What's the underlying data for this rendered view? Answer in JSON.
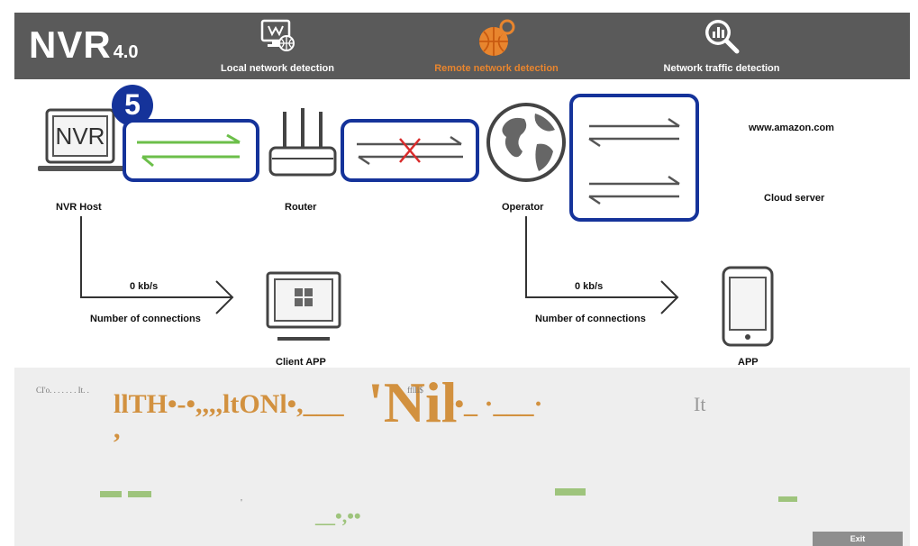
{
  "header": {
    "logo_main": "NVR",
    "logo_version": "4.0",
    "tabs": [
      {
        "label": "Local network detection",
        "icon": "monitor-network-icon"
      },
      {
        "label": "Remote network detection",
        "icon": "globe-search-icon",
        "active": true
      },
      {
        "label": "Network traffic detection",
        "icon": "magnifier-chart-icon"
      }
    ]
  },
  "diagram": {
    "step_number": "5",
    "nodes": {
      "nvr_host": "NVR Host",
      "nvr_screen_text": "NVR",
      "router": "Router",
      "operator": "Operator",
      "cloud_domain": "www.amazon.com",
      "cloud_server": "Cloud server",
      "client_app": "Client APP",
      "app": "APP"
    },
    "left_branch": {
      "speed": "0 kb/s",
      "connections_label": "Number of connections"
    },
    "right_branch": {
      "speed": "0 kb/s",
      "connections_label": "Number of connections"
    }
  },
  "overlay": {
    "small_left": "CI'o. . . . . . . It. .",
    "main_garble_a": "llTH•-•,,,,ltONl•,___",
    "main_garble_b": "'Nil",
    "main_garble_c": "••_ ·___·",
    "small_mid": "fflli$",
    "right_text": "It",
    "comma": ",",
    "dot_text": "'",
    "lower_garble": "__•,••"
  },
  "footer": {
    "exit_label": "Exit"
  },
  "colors": {
    "accent": "#15339a",
    "active_tab": "#e8852e",
    "link_ok": "#6cbf4a",
    "link_bad": "#d92b2b",
    "garble": "#d2913f"
  }
}
